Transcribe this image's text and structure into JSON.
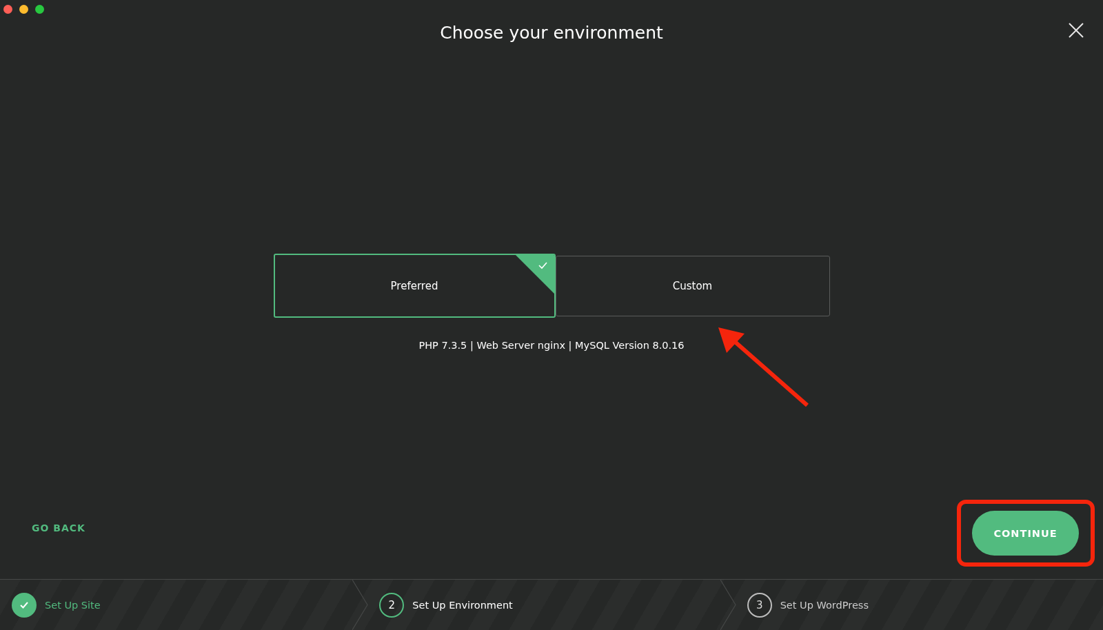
{
  "window": {
    "title": "Choose your environment"
  },
  "options": [
    {
      "label": "Preferred",
      "selected": true
    },
    {
      "label": "Custom",
      "selected": false
    }
  ],
  "details": "PHP 7.3.5 | Web Server nginx | MySQL Version 8.0.16",
  "back_link": "GO BACK",
  "continue_button": "CONTINUE",
  "steps": [
    {
      "label": "Set Up Site",
      "completed": true,
      "selected": false
    },
    {
      "number": "2",
      "label": "Set Up Environment",
      "completed": false,
      "selected": true
    },
    {
      "number": "3",
      "label": "Set Up WordPress",
      "completed": false,
      "selected": false
    }
  ]
}
